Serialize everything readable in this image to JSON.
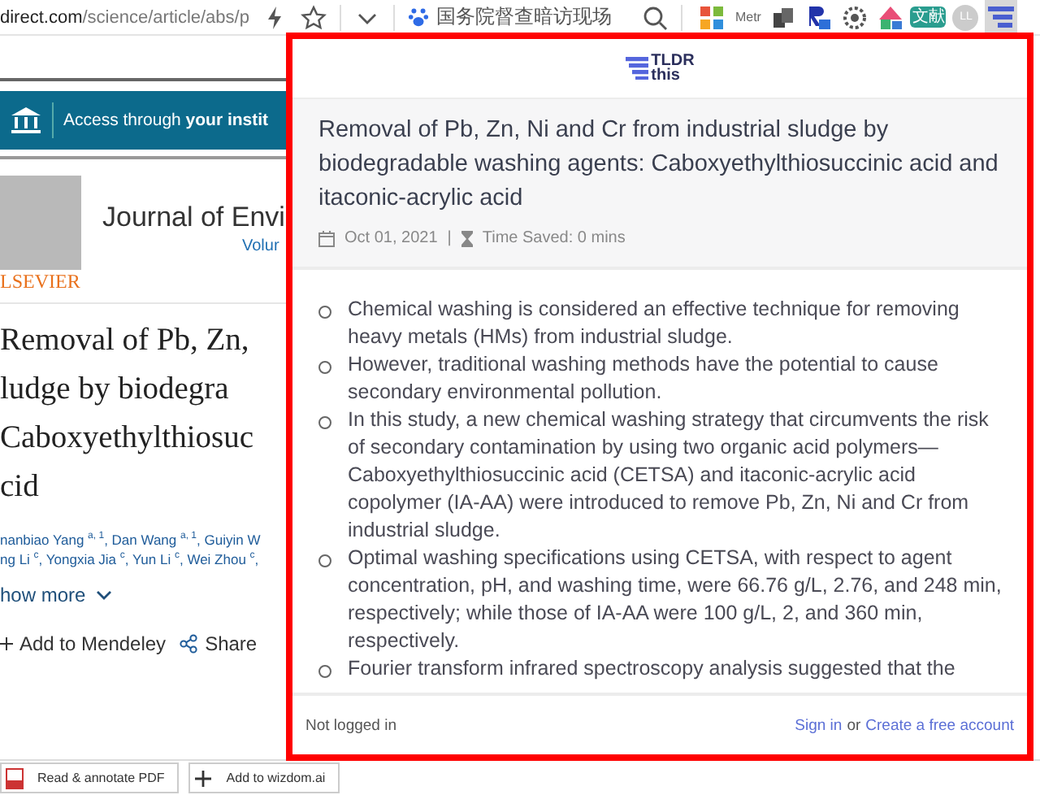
{
  "toolbar": {
    "url_host": "direct.com",
    "url_path": "/science/article/abs/p",
    "search": {
      "value": "国务院督查暗访现场"
    },
    "extensions": [
      {
        "kind": "tiles",
        "selected": false
      },
      {
        "kind": "text",
        "label": "Metr",
        "selected": false
      },
      {
        "kind": "cubes",
        "selected": false
      },
      {
        "kind": "rbox",
        "selected": false
      },
      {
        "kind": "gear",
        "selected": false
      },
      {
        "kind": "shapes",
        "selected": false
      },
      {
        "kind": "badge",
        "label": "文献",
        "selected": false
      },
      {
        "kind": "avatar",
        "label": "LL",
        "selected": false
      },
      {
        "kind": "lines",
        "selected": true
      }
    ]
  },
  "article": {
    "access": "Access through **your instit**",
    "journal": "Journal of Envi",
    "volume": "Volur",
    "publisher": "LSEVIER",
    "title_lines": [
      "Removal of Pb, Zn,",
      "ludge by biodegra",
      "Caboxyethylthiosuc",
      "cid"
    ],
    "author_lines": [
      "nanbiao Yang $^{a, 1}$, Dan Wang $^{a, 1}$, Guiyin W",
      "ng Li $^{c}$, Yongxia Jia $^{c}$, Yun Li $^{c}$, Wei Zhou $^{c}$,"
    ],
    "show_more": "how more",
    "actions": [
      "Add to Mendeley",
      "Share"
    ]
  },
  "bottom_bar": {
    "buttons": [
      "Read & annotate PDF",
      "Add to wizdom.ai"
    ]
  },
  "popup": {
    "logo": {
      "line_1": "TLDR",
      "line_2": "this"
    },
    "title": "Removal of Pb, Zn, Ni and Cr from industrial sludge by biodegradable washing agents: Caboxyethylthiosuccinic acid and itaconic-acrylic acid",
    "date": "Oct 01, 2021",
    "separator": "|",
    "time_saved": "Time Saved: 0 mins",
    "bullets": [
      "Chemical washing is considered an effective technique for removing heavy metals (HMs) from industrial sludge.",
      "However, traditional washing methods have the potential to cause secondary environmental pollution.",
      "In this study, a new chemical washing strategy that circumvents the risk of secondary contamination by using two organic acid polymers—Caboxyethylthiosuccinic acid (CETSA) and itaconic-acrylic acid copolymer (IA-AA) were introduced to remove Pb, Zn, Ni and Cr from industrial sludge.",
      "Optimal washing specifications using CETSA, with respect to agent concentration, pH, and washing time, were 66.76 g/L, 2.76, and 248 min, respectively; while those of IA-AA were 100 g/L, 2, and 360 min, respectively.",
      "Fourier transform infrared spectroscopy analysis suggested that the"
    ],
    "footer": {
      "status": "Not logged in",
      "sign_in": "Sign in",
      "or": "or",
      "create": "Create a free account"
    }
  }
}
